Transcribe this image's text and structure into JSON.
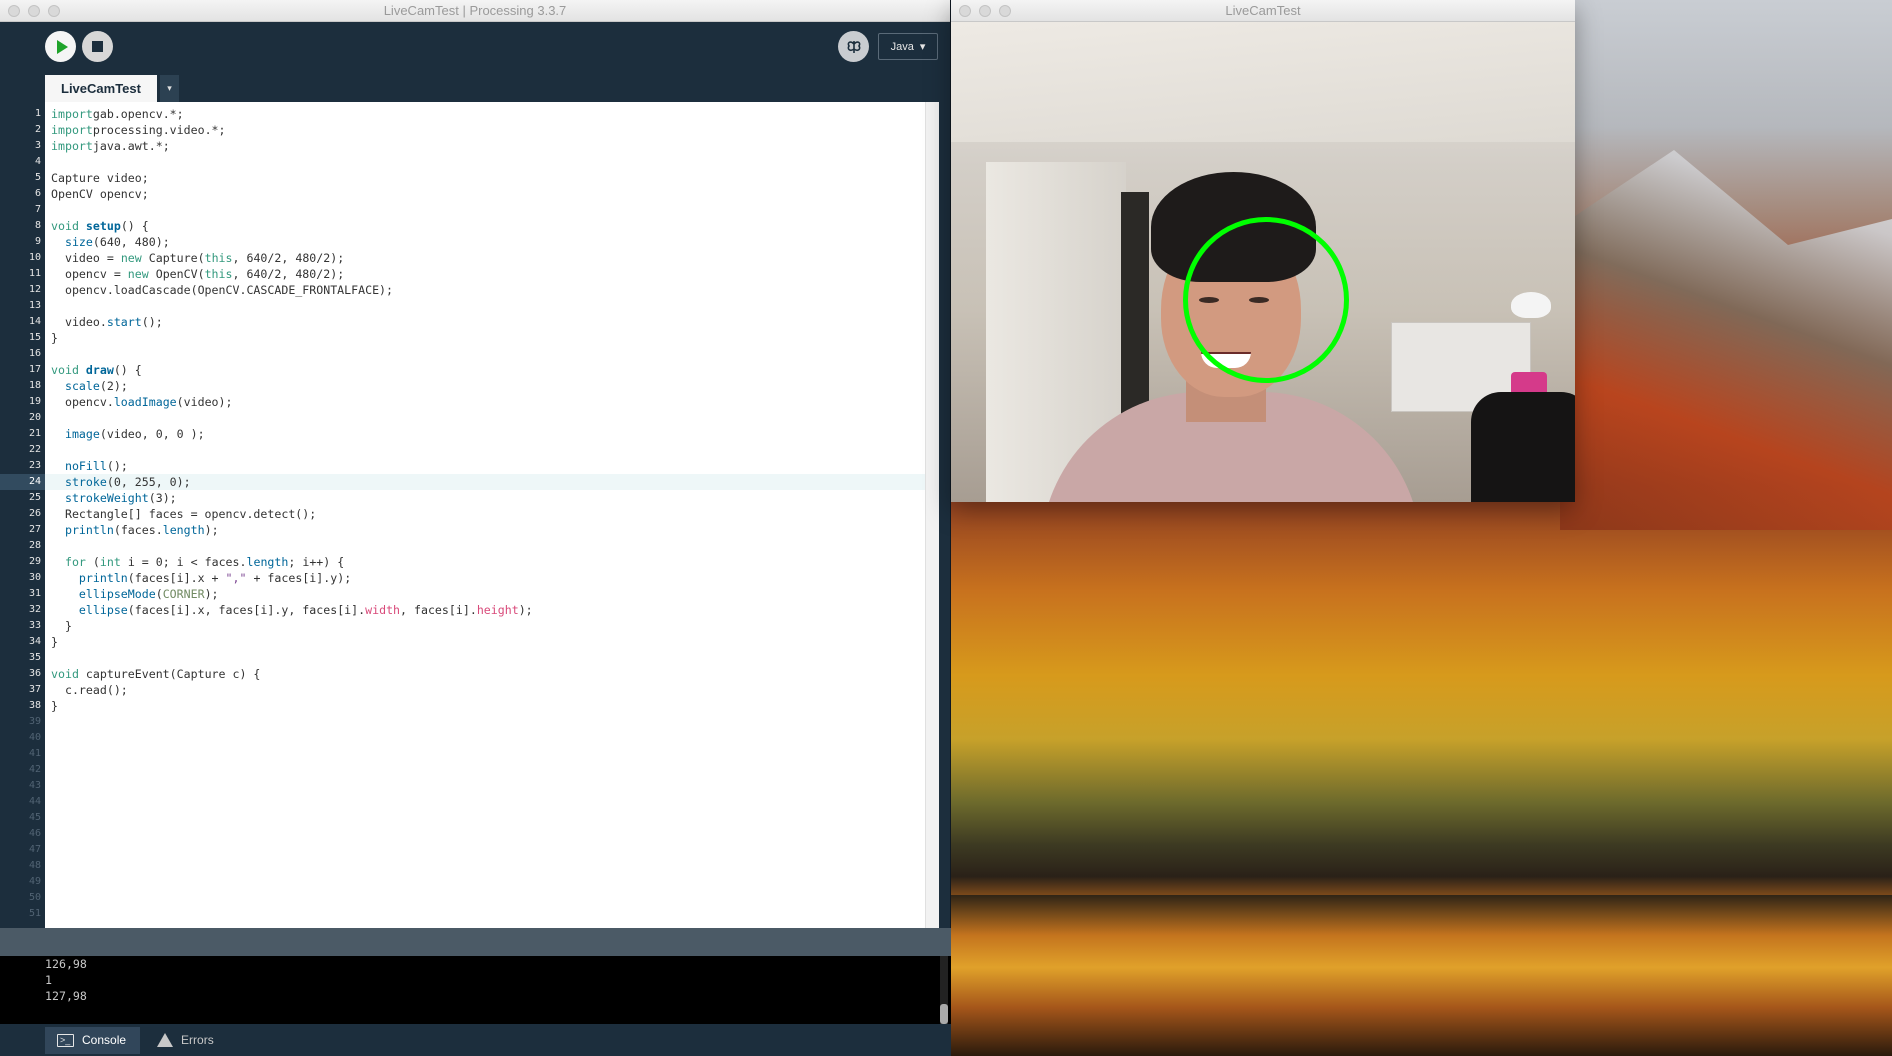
{
  "ide": {
    "window_title": "LiveCamTest | Processing 3.3.7",
    "mode_label": "Java",
    "mode_arrow": "▾",
    "tab_label": "LiveCamTest",
    "tab_menu_arrow": "▾",
    "highlighted_line": 24,
    "code": [
      [
        [
          "kw",
          "import"
        ],
        [
          "",
          "gab.opencv.*;"
        ]
      ],
      [
        [
          "kw",
          "import"
        ],
        [
          "",
          "processing.video.*;"
        ]
      ],
      [
        [
          "kw",
          "import"
        ],
        [
          "",
          "java.awt.*;"
        ]
      ],
      [],
      [
        [
          "",
          "Capture video;"
        ]
      ],
      [
        [
          "",
          "OpenCV opencv;"
        ]
      ],
      [],
      [
        [
          "kw",
          "void "
        ],
        [
          "fnb",
          "setup"
        ],
        [
          "",
          "() {"
        ]
      ],
      [
        [
          "",
          "  "
        ],
        [
          "fn",
          "size"
        ],
        [
          "",
          "(640, 480);"
        ]
      ],
      [
        [
          "",
          "  video = "
        ],
        [
          "kw",
          "new"
        ],
        [
          "",
          " Capture("
        ],
        [
          "kw",
          "this"
        ],
        [
          "",
          ", 640/2, 480/2);"
        ]
      ],
      [
        [
          "",
          "  opencv = "
        ],
        [
          "kw",
          "new"
        ],
        [
          "",
          " OpenCV("
        ],
        [
          "kw",
          "this"
        ],
        [
          "",
          ", 640/2, 480/2);"
        ]
      ],
      [
        [
          "",
          "  opencv.loadCascade(OpenCV.CASCADE_FRONTALFACE);"
        ]
      ],
      [],
      [
        [
          "",
          "  video."
        ],
        [
          "fn",
          "start"
        ],
        [
          "",
          "();"
        ]
      ],
      [
        [
          "",
          "}"
        ]
      ],
      [],
      [
        [
          "kw",
          "void "
        ],
        [
          "fnb",
          "draw"
        ],
        [
          "",
          "() {"
        ]
      ],
      [
        [
          "",
          "  "
        ],
        [
          "fn",
          "scale"
        ],
        [
          "",
          "(2);"
        ]
      ],
      [
        [
          "",
          "  opencv."
        ],
        [
          "fn",
          "loadImage"
        ],
        [
          "",
          "(video);"
        ]
      ],
      [],
      [
        [
          "",
          "  "
        ],
        [
          "fn",
          "image"
        ],
        [
          "",
          "(video, 0, 0 );"
        ]
      ],
      [],
      [
        [
          "",
          "  "
        ],
        [
          "fn",
          "noFill"
        ],
        [
          "",
          "();"
        ]
      ],
      [
        [
          "",
          "  "
        ],
        [
          "fn",
          "stroke"
        ],
        [
          "",
          "(0, 255, 0);"
        ]
      ],
      [
        [
          "",
          "  "
        ],
        [
          "fn",
          "strokeWeight"
        ],
        [
          "",
          "(3);"
        ]
      ],
      [
        [
          "",
          "  Rectangle[] faces = opencv.detect();"
        ]
      ],
      [
        [
          "",
          "  "
        ],
        [
          "fn",
          "println"
        ],
        [
          "",
          "(faces."
        ],
        [
          "fn",
          "length"
        ],
        [
          "",
          "); "
        ]
      ],
      [],
      [
        [
          "",
          "  "
        ],
        [
          "kw",
          "for"
        ],
        [
          "",
          " ("
        ],
        [
          "kw",
          "int"
        ],
        [
          "",
          " i = 0; i < faces."
        ],
        [
          "fn",
          "length"
        ],
        [
          "",
          "; i++) {"
        ]
      ],
      [
        [
          "",
          "    "
        ],
        [
          "fn",
          "println"
        ],
        [
          "",
          "(faces[i].x + "
        ],
        [
          "str",
          "\",\""
        ],
        [
          "",
          " + faces[i].y);"
        ]
      ],
      [
        [
          "",
          "    "
        ],
        [
          "fn",
          "ellipseMode"
        ],
        [
          "",
          "("
        ],
        [
          "cst",
          "CORNER"
        ],
        [
          "",
          ");"
        ]
      ],
      [
        [
          "",
          "    "
        ],
        [
          "fn",
          "ellipse"
        ],
        [
          "",
          "(faces[i].x, faces[i].y, faces[i]."
        ],
        [
          "prop",
          "width"
        ],
        [
          "",
          ", faces[i]."
        ],
        [
          "prop",
          "height"
        ],
        [
          "",
          ");"
        ]
      ],
      [
        [
          "",
          "  }"
        ]
      ],
      [
        [
          "",
          "}"
        ]
      ],
      [],
      [
        [
          "kw",
          "void "
        ],
        [
          "",
          "captureEvent(Capture c) {"
        ]
      ],
      [
        [
          "",
          "  c.read();"
        ]
      ],
      [
        [
          "",
          "}"
        ]
      ]
    ],
    "empty_line_numbers": [
      "39",
      "40",
      "41",
      "42",
      "43",
      "44",
      "45",
      "46",
      "47",
      "48",
      "49",
      "50",
      "51"
    ],
    "console_lines": [
      "126,98",
      "1",
      "127,98"
    ],
    "console_tab_label": "Console",
    "errors_tab_label": "Errors",
    "console_icon_glyph": ">_"
  },
  "sketch": {
    "window_title": "LiveCamTest",
    "detection_color": "#00ff00"
  },
  "colors": {
    "ide_background": "#1c2e3d",
    "run_green": "#1fa32a"
  }
}
